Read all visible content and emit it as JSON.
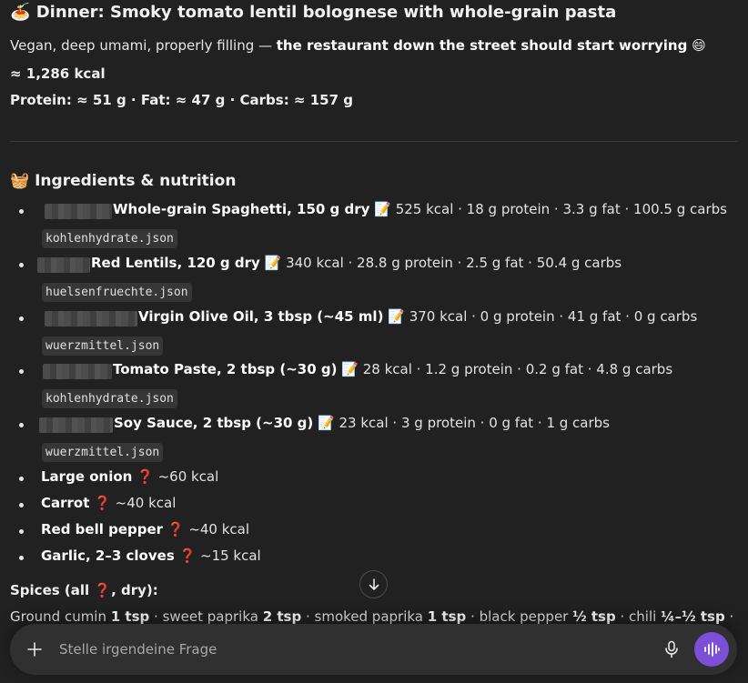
{
  "message": {
    "title_emoji": "🍝",
    "title": "Dinner: Smoky tomato lentil bolognese with whole-grain pasta",
    "subtitle_plain": "Vegan, deep umami, properly filling — ",
    "subtitle_bold": "the restaurant down the street should start worrying",
    "subtitle_emoji": "😄",
    "kcal": "≈ 1,286 kcal",
    "macros": "Protein: ≈ 51 g · Fat: ≈ 47 g · Carbs: ≈ 157 g",
    "ingredients_title_emoji": "🧺",
    "ingredients_title": "Ingredients & nutrition",
    "ingredients": [
      {
        "name": "Whole-grain Spaghetti, 150 g dry",
        "note_emoji": "📝",
        "nutrition": "525 kcal · 18 g protein · 3.3 g fat · 100.5 g carbs",
        "file": "kohlenhydrate.json"
      },
      {
        "name": "Red Lentils, 120 g dry",
        "note_emoji": "📝",
        "nutrition": "340 kcal · 28.8 g protein · 2.5 g fat · 50.4 g carbs",
        "file": "huelsenfruechte.json"
      },
      {
        "name": "Virgin Olive Oil, 3 tbsp (~45 ml)",
        "note_emoji": "📝",
        "nutrition": "370 kcal · 0 g protein · 41 g fat · 0 g carbs",
        "file": "wuerzmittel.json"
      },
      {
        "name": "Tomato Paste, 2 tbsp (~30 g)",
        "note_emoji": "📝",
        "nutrition": "28 kcal · 1.2 g protein · 0.2 g fat · 4.8 g carbs",
        "file": "kohlenhydrate.json"
      },
      {
        "name": "Soy Sauce, 2 tbsp (~30 g)",
        "note_emoji": "📝",
        "nutrition": "23 kcal · 3 g protein · 0 g fat · 1 g carbs",
        "file": "wuerzmittel.json"
      }
    ],
    "simple_items": [
      {
        "name": "Large onion",
        "mark": "❓",
        "kcal": "~60 kcal"
      },
      {
        "name": "Carrot",
        "mark": "❓",
        "kcal": "~40 kcal"
      },
      {
        "name": "Red bell pepper",
        "mark": "❓",
        "kcal": "~40 kcal"
      },
      {
        "name": "Garlic, 2–3 cloves",
        "mark": "❓",
        "kcal": "~15 kcal"
      }
    ],
    "spices_title_a": "Spices (all ",
    "spices_title_mark": "❓",
    "spices_title_b": ", dry):",
    "spices": [
      {
        "name": "Ground cumin ",
        "amount": "1 tsp",
        "sep": " · "
      },
      {
        "name": "sweet paprika ",
        "amount": "2 tsp",
        "sep": " · "
      },
      {
        "name": "smoked paprika ",
        "amount": "1 tsp",
        "sep": " · "
      },
      {
        "name": "black pepper ",
        "amount": "½ tsp",
        "sep": " · "
      },
      {
        "name": "chili ",
        "amount": "¼–½ tsp",
        "sep": " ·"
      }
    ]
  },
  "composer": {
    "placeholder": "Stelle irgendeine Frage"
  },
  "icons": {
    "scroll_down": "arrow-down-icon",
    "add": "plus-icon",
    "mic": "microphone-icon",
    "voice": "voice-mode-icon"
  },
  "colors": {
    "background": "#212121",
    "composer": "#303030",
    "voice_button": "#7b4fd6",
    "question_mark": "#e0243a",
    "file_chip": "#363636"
  }
}
